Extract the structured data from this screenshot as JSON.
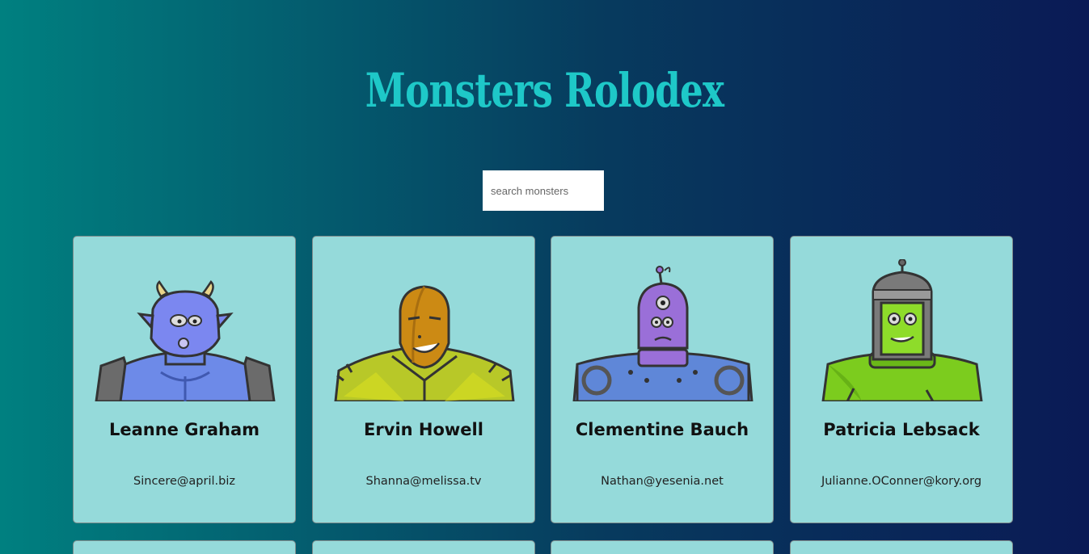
{
  "app": {
    "title": "Monsters Rolodex"
  },
  "search": {
    "placeholder": "search monsters",
    "value": ""
  },
  "monsters": [
    {
      "name": "Leanne Graham",
      "email": "Sincere@april.biz",
      "avatar_icon": "blue-horned-monster-icon"
    },
    {
      "name": "Ervin Howell",
      "email": "Shanna@melissa.tv",
      "avatar_icon": "orange-spiky-monster-icon"
    },
    {
      "name": "Clementine Bauch",
      "email": "Nathan@yesenia.net",
      "avatar_icon": "purple-cyclops-robot-monster-icon"
    },
    {
      "name": "Patricia Lebsack",
      "email": "Julianne.OConner@kory.org",
      "avatar_icon": "green-frankenstein-monster-icon"
    }
  ],
  "colors": {
    "card_background": "#95dada",
    "title": "#1ec8c8",
    "gradient_left": "#008080",
    "gradient_right": "#0a1a55"
  }
}
